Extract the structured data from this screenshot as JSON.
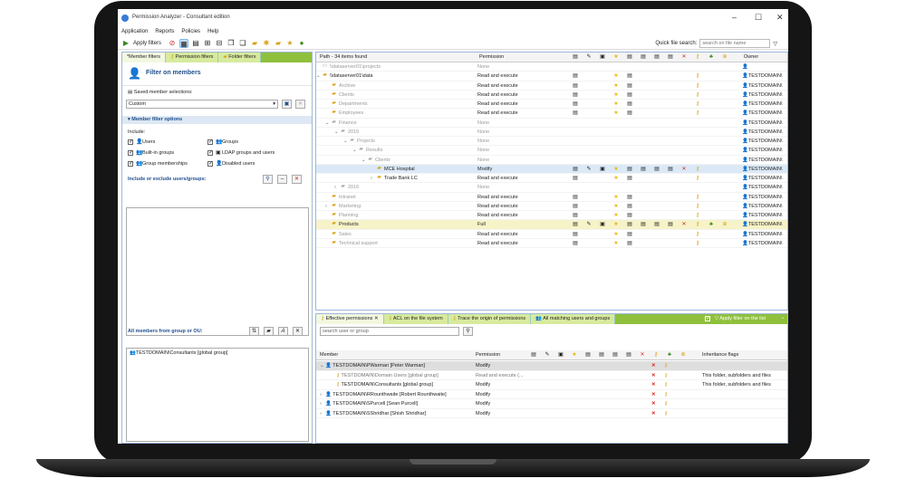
{
  "window": {
    "title": "Permission Analyzer - Consultant edition"
  },
  "menu": [
    "Application",
    "Reports",
    "Policies",
    "Help"
  ],
  "toolbar": {
    "apply_label": "Apply filters",
    "quick_search_label": "Quick file search:",
    "quick_search_placeholder": "search on file name"
  },
  "left": {
    "tabs": [
      "Member filters",
      "Permission filters",
      "Folder filters"
    ],
    "heading": "Filter on members",
    "saved_label": "Saved member selections:",
    "saved_value": "Custom",
    "options_section": "Member filter options",
    "include_label": "Include:",
    "checks": [
      "Users",
      "Groups",
      "Built-in groups",
      "LDAP groups and users",
      "Group memberships",
      "Disabled users"
    ],
    "include_exclude_label": "Include or exclude users/groups:",
    "all_members_label": "All members from group or OU:",
    "member_item": "TESTDOMAIN\\Consultants [global group]"
  },
  "grid": {
    "headers": {
      "path": "Path - 34 items found",
      "permission": "Permission",
      "owner": "Owner"
    },
    "rows": [
      {
        "path": "\\\\dataserver01\\projects",
        "perm": "None",
        "owner": "",
        "indent": 0,
        "gray": true,
        "icon": "server"
      },
      {
        "path": "\\\\dataserver01\\data",
        "perm": "Read and execute",
        "owner": "TESTDOMAIN\\",
        "indent": 0,
        "gray": false,
        "icon": "folder"
      },
      {
        "path": "Archive",
        "perm": "Read and execute",
        "owner": "TESTDOMAIN\\",
        "indent": 1,
        "gray": true,
        "icon": "folder"
      },
      {
        "path": "Clients",
        "perm": "Read and execute",
        "owner": "TESTDOMAIN\\",
        "indent": 1,
        "gray": true,
        "icon": "folder"
      },
      {
        "path": "Departments",
        "perm": "Read and execute",
        "owner": "TESTDOMAIN\\",
        "indent": 1,
        "gray": true,
        "icon": "folder"
      },
      {
        "path": "Employees",
        "perm": "Read and execute",
        "owner": "TESTDOMAIN\\",
        "indent": 1,
        "gray": true,
        "icon": "folder"
      },
      {
        "path": "Finance",
        "perm": "None",
        "owner": "TESTDOMAIN\\",
        "indent": 1,
        "gray": true,
        "icon": "gfolder"
      },
      {
        "path": "2015",
        "perm": "None",
        "owner": "TESTDOMAIN\\",
        "indent": 2,
        "gray": true,
        "icon": "gfolder"
      },
      {
        "path": "Projects",
        "perm": "None",
        "owner": "TESTDOMAIN\\",
        "indent": 3,
        "gray": true,
        "icon": "gfolder"
      },
      {
        "path": "Results",
        "perm": "None",
        "owner": "TESTDOMAIN\\",
        "indent": 4,
        "gray": true,
        "icon": "gfolder"
      },
      {
        "path": "Clients",
        "perm": "None",
        "owner": "TESTDOMAIN\\",
        "indent": 5,
        "gray": true,
        "icon": "gfolder"
      },
      {
        "path": "MCE Hospital",
        "perm": "Modify",
        "owner": "TESTDOMAIN\\",
        "indent": 6,
        "gray": false,
        "icon": "folder",
        "sel": true
      },
      {
        "path": "Trade Bank LC",
        "perm": "Read and execute",
        "owner": "TESTDOMAIN\\",
        "indent": 6,
        "gray": false,
        "icon": "folder"
      },
      {
        "path": "2016",
        "perm": "None",
        "owner": "TESTDOMAIN\\",
        "indent": 2,
        "gray": true,
        "icon": "gfolder"
      },
      {
        "path": "Intranet",
        "perm": "Read and execute",
        "owner": "TESTDOMAIN\\",
        "indent": 1,
        "gray": true,
        "icon": "folder"
      },
      {
        "path": "Marketing",
        "perm": "Read and execute",
        "owner": "TESTDOMAIN\\",
        "indent": 1,
        "gray": true,
        "icon": "folder"
      },
      {
        "path": "Planning",
        "perm": "Read and execute",
        "owner": "TESTDOMAIN\\",
        "indent": 1,
        "gray": true,
        "icon": "folder"
      },
      {
        "path": "Products",
        "perm": "Full",
        "owner": "TESTDOMAIN\\",
        "indent": 1,
        "gray": false,
        "icon": "folder",
        "hl": true
      },
      {
        "path": "Sales",
        "perm": "Read and execute",
        "owner": "TESTDOMAIN\\",
        "indent": 1,
        "gray": true,
        "icon": "folder"
      },
      {
        "path": "Technical support",
        "perm": "Read and execute",
        "owner": "TESTDOMAIN\\",
        "indent": 1,
        "gray": true,
        "icon": "folder"
      }
    ]
  },
  "bottom": {
    "tabs": [
      "Effective permissions",
      "ACL on the file system",
      "Trace the origin of permissions",
      "All matching users and groups"
    ],
    "apply_on_list": "Apply filter on the list",
    "search_placeholder": "search user or group",
    "headers": {
      "member": "Member",
      "permission": "Permission",
      "flags": "Inheritance flags"
    },
    "rows": [
      {
        "member": "TESTDOMAIN\\PWarman [Peter Warman]",
        "perm": "Modify",
        "flags": "",
        "sel": true
      },
      {
        "member": "TESTDOMAIN\\Domain Users [global group]",
        "perm": "Read and execute (...",
        "flags": "This folder, subfolders and files",
        "sub": true
      },
      {
        "member": "TESTDOMAIN\\Consultants [global group]",
        "perm": "Modify",
        "flags": "This folder, subfolders and files",
        "sub": true
      },
      {
        "member": "TESTDOMAIN\\RRounthwaite [Robert Rounthwaite]",
        "perm": "Modify",
        "flags": ""
      },
      {
        "member": "TESTDOMAIN\\SPurcell [Sean Purcell]",
        "perm": "Modify",
        "flags": ""
      },
      {
        "member": "TESTDOMAIN\\SShridhar [Shish Shridhar]",
        "perm": "Modify",
        "flags": ""
      }
    ]
  }
}
